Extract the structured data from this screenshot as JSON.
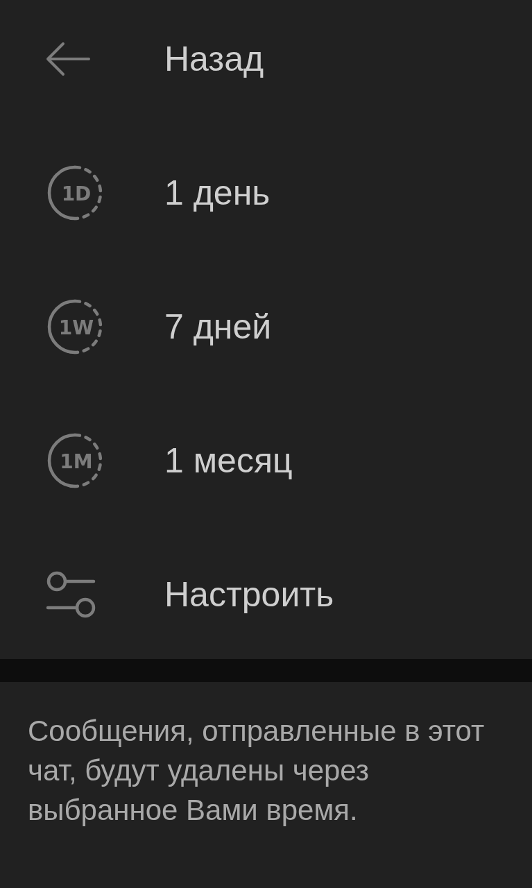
{
  "menu": {
    "items": [
      {
        "kind": "back",
        "label": "Назад"
      },
      {
        "kind": "timer",
        "badge": "1D",
        "label": "1 день"
      },
      {
        "kind": "timer",
        "badge": "1W",
        "label": "7 дней"
      },
      {
        "kind": "timer",
        "badge": "1M",
        "label": "1 месяц"
      },
      {
        "kind": "custom",
        "label": "Настроить"
      }
    ]
  },
  "footer": {
    "text": "Сообщения, отправленные в этот чат, будут удалены через выбранное Вами время."
  }
}
